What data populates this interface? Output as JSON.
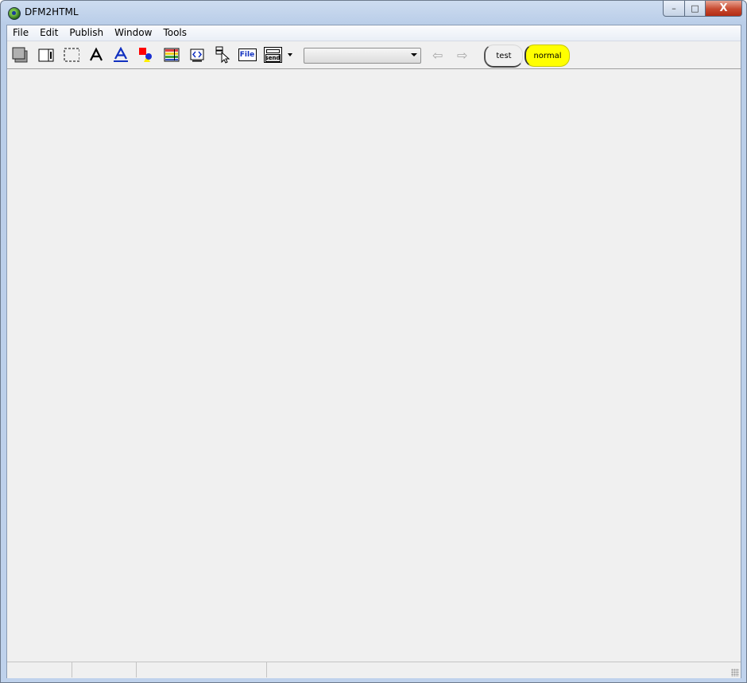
{
  "window": {
    "title": "DFM2HTML",
    "app_icon": "dfm2html-app-icon"
  },
  "caption_buttons": {
    "minimize": "–",
    "maximize": "□",
    "close": "X"
  },
  "menu": [
    "File",
    "Edit",
    "Publish",
    "Window",
    "Tools"
  ],
  "toolbar": {
    "icons": [
      "panel-tool-icon",
      "page-tool-icon",
      "frame-tool-icon",
      "text-tool-icon",
      "hyperlink-tool-icon",
      "color-tool-icon",
      "table-tool-icon",
      "html-tool-icon",
      "input-tool-icon",
      "file-upload-tool-icon",
      "send-form-tool-icon",
      "dropdown-arrow-icon"
    ],
    "file_label": "File",
    "send_label": "send",
    "combo_value": "",
    "back_glyph": "⇦",
    "forward_glyph": "⇨",
    "style_buttons": [
      {
        "label": "test",
        "color": "#f0f0f0"
      },
      {
        "label": "normal",
        "color": "#ffff00"
      }
    ]
  },
  "statusbar": {
    "panels": [
      "",
      "",
      "",
      ""
    ]
  }
}
